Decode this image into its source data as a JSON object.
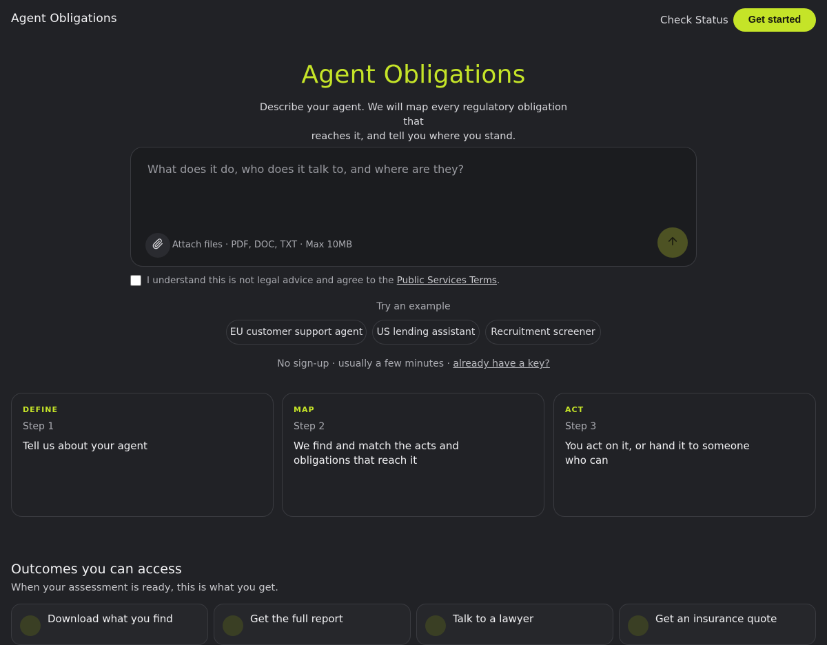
{
  "header": {
    "brand": "Agent Obligations",
    "check_status": "Check Status",
    "get_started": "Get started"
  },
  "hero": {
    "title": "Agent Obligations",
    "subtitle_line1": "Describe your agent. We will map every regulatory obligation that",
    "subtitle_line2": "reaches it, and tell you where you stand."
  },
  "composer": {
    "placeholder": "What does it do, who does it talk to, and where are they?",
    "attach_hint": "Attach files · PDF, DOC, TXT · Max 10MB",
    "attach_icon": "paperclip-icon",
    "send_icon": "arrow-up-icon"
  },
  "consent": {
    "text": "I understand this is not legal advice and agree to the ",
    "link": "Public Services Terms",
    "suffix": "."
  },
  "examples": {
    "label": "Try an example",
    "chips": [
      "EU customer support agent",
      "US lending assistant",
      "Recruitment screener"
    ]
  },
  "note": {
    "text": "No sign-up · usually a few minutes · ",
    "link": "already have a key?"
  },
  "steps": [
    {
      "eyebrow": "DEFINE",
      "step": "Step 1",
      "heading": "Tell us about your agent"
    },
    {
      "eyebrow": "MAP",
      "step": "Step 2",
      "heading": "We find and match the acts and obligations that reach it"
    },
    {
      "eyebrow": "ACT",
      "step": "Step 3",
      "heading": "You act on it, or hand it to someone who can"
    }
  ],
  "outcomes": {
    "title": "Outcomes you can access",
    "subtitle": "When your assessment is ready, this is what you get.",
    "items": [
      {
        "label": "Download what you find"
      },
      {
        "label": "Get the full report"
      },
      {
        "label": "Talk to a lawyer"
      },
      {
        "label": "Get an insurance quote"
      }
    ]
  },
  "colors": {
    "accent": "#c5e428",
    "background": "#212226"
  }
}
